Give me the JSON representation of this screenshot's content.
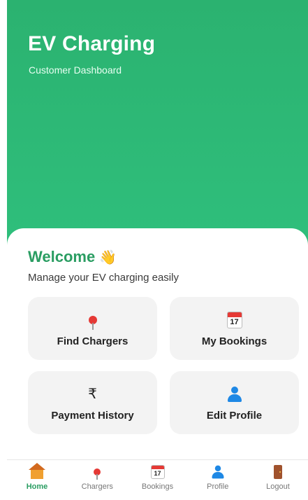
{
  "header": {
    "title": "EV Charging",
    "subtitle": "Customer Dashboard"
  },
  "welcome": {
    "title": "Welcome",
    "emoji": "👋",
    "tagline": "Manage your EV charging easily"
  },
  "tiles": [
    {
      "label": "Find Chargers",
      "icon": "map-pin-icon"
    },
    {
      "label": "My Bookings",
      "icon": "calendar-icon",
      "calendar_day": "17"
    },
    {
      "label": "Payment History",
      "icon": "rupee-icon",
      "symbol": "₹"
    },
    {
      "label": "Edit Profile",
      "icon": "user-icon"
    }
  ],
  "nav": [
    {
      "label": "Home",
      "icon": "home-icon",
      "active": true
    },
    {
      "label": "Chargers",
      "icon": "map-pin-icon"
    },
    {
      "label": "Bookings",
      "icon": "calendar-icon",
      "calendar_day": "17"
    },
    {
      "label": "Profile",
      "icon": "user-icon"
    },
    {
      "label": "Logout",
      "icon": "door-icon"
    }
  ],
  "colors": {
    "brand_green": "#2fbf7c",
    "welcome_green": "#2a9d62",
    "tile_bg": "#f3f3f3"
  }
}
